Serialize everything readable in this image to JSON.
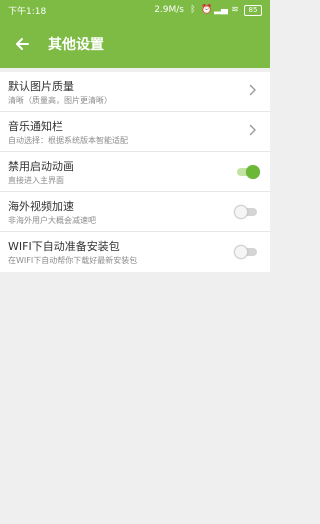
{
  "status": {
    "time": "下午1:18",
    "speed": "2.9M/s",
    "battery": "85"
  },
  "appbar": {
    "title": "其他设置"
  },
  "settings": [
    {
      "title": "默认图片质量",
      "subtitle": "清晰（质量高，图片更清晰）",
      "control": "chevron"
    },
    {
      "title": "音乐通知栏",
      "subtitle": "自动选择：根据系统版本智能适配",
      "control": "chevron"
    },
    {
      "title": "禁用启动动画",
      "subtitle": "直接进入主界面",
      "control": "toggle",
      "on": true
    },
    {
      "title": "海外视频加速",
      "subtitle": "非海外用户大概会减速吧",
      "control": "toggle",
      "on": false
    },
    {
      "title": "WIFI下自动准备安装包",
      "subtitle": "在WIFI下自动帮你下载好最新安装包",
      "control": "toggle",
      "on": false
    }
  ],
  "colors": {
    "accent": "#7dbb44",
    "toggle_on": "#6bb836",
    "background": "#efefef"
  }
}
